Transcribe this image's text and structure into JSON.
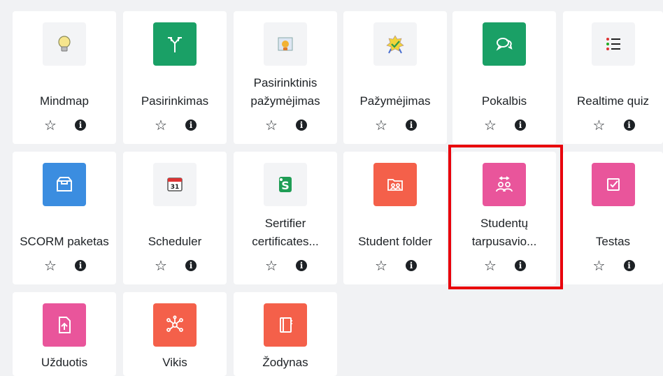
{
  "highlight_color": "#e8000b",
  "corner_label": "...",
  "cards": [
    {
      "name": "mindmap",
      "label": "Mindmap",
      "icon": "lightbulb-icon",
      "color": "#f8f9fa"
    },
    {
      "name": "pasirinkimas",
      "label": "Pasirinkimas",
      "icon": "choice-arrows-icon",
      "color": "#1aa066"
    },
    {
      "name": "pasirinktinis",
      "label": "Pasirinktinis pažymėjimas",
      "icon": "certificate-icon",
      "color": "#f8f9fa"
    },
    {
      "name": "pazymejimas",
      "label": "Pažymėjimas",
      "icon": "badge-icon",
      "color": "#f8f9fa"
    },
    {
      "name": "pokalbis",
      "label": "Pokalbis",
      "icon": "chat-icon",
      "color": "#1aa066"
    },
    {
      "name": "realtime-quiz",
      "label": "Realtime quiz",
      "icon": "list-icon",
      "color": "#f8f9fa"
    },
    {
      "name": "scorm",
      "label": "SCORM paketas",
      "icon": "package-icon",
      "color": "#3b8de0"
    },
    {
      "name": "scheduler",
      "label": "Scheduler",
      "icon": "calendar-icon",
      "color": "#f8f9fa"
    },
    {
      "name": "sertifier",
      "label": "Sertifier certificates...",
      "icon": "sertifier-icon",
      "color": "#f8f9fa"
    },
    {
      "name": "student-folder",
      "label": "Student folder",
      "icon": "folder-icon",
      "color": "#f4604a"
    },
    {
      "name": "studentu",
      "label": "Studentų tarpusavio...",
      "icon": "peer-icon",
      "color": "#e9559b"
    },
    {
      "name": "testas",
      "label": "Testas",
      "icon": "checkbox-icon",
      "color": "#e9559b"
    },
    {
      "name": "uzduotis",
      "label": "Užduotis",
      "icon": "upload-file-icon",
      "color": "#e9559b"
    },
    {
      "name": "vikis",
      "label": "Vikis",
      "icon": "network-icon",
      "color": "#f4604a"
    },
    {
      "name": "zodynas",
      "label": "Žodynas",
      "icon": "book-icon",
      "color": "#f4604a"
    }
  ]
}
